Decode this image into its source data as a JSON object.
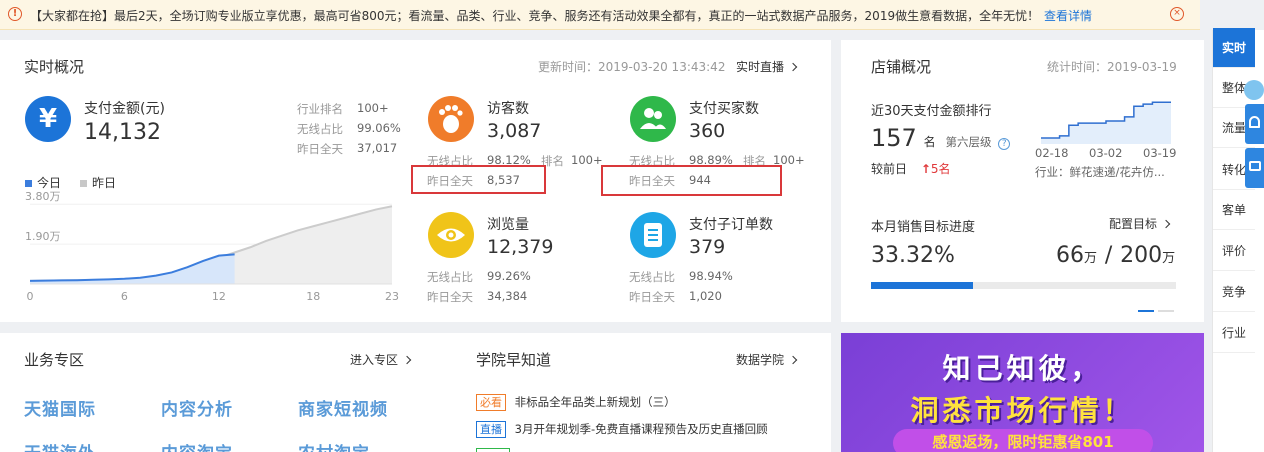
{
  "notice": {
    "text": "【大家都在抢】最后2天，全场订购专业版立享优惠，最高可省800元；看流量、品类、行业、竞争、服务还有活动效果全都有，真正的一站式数据产品服务，2019做生意看数据，全年无忧！",
    "link": "查看详情",
    "icon": "!",
    "close_icon": "×"
  },
  "realtime": {
    "title": "实时概况",
    "update_time": "更新时间：2019-03-20 13:43:42",
    "live_link": "实时直播",
    "pay_amount": {
      "label": "支付金额(元)",
      "value": "14,132",
      "icon": "¥",
      "stats": [
        {
          "label": "行业排名",
          "value": "100+"
        },
        {
          "label": "无线占比",
          "value": "99.06%"
        },
        {
          "label": "昨日全天",
          "value": "37,017"
        }
      ]
    },
    "legend": {
      "today": "今日",
      "yesterday": "昨日"
    },
    "metrics": [
      {
        "label": "访客数",
        "value": "3,087",
        "color": "#f07c2a",
        "icon": "foot-icon",
        "wireless_label": "无线占比",
        "wireless": "98.12%",
        "rank_label": "排名",
        "rank": "100+",
        "yesterday_label": "昨日全天",
        "yesterday": "8,537"
      },
      {
        "label": "支付买家数",
        "value": "360",
        "color": "#2fb84a",
        "icon": "buyers-icon",
        "wireless_label": "无线占比",
        "wireless": "98.89%",
        "rank_label": "排名",
        "rank": "100+",
        "yesterday_label": "昨日全天",
        "yesterday": "944"
      },
      {
        "label": "浏览量",
        "value": "12,379",
        "color": "#f0c419",
        "icon": "eye-icon",
        "wireless_label": "无线占比",
        "wireless": "99.26%",
        "yesterday_label": "昨日全天",
        "yesterday": "34,384"
      },
      {
        "label": "支付子订单数",
        "value": "379",
        "color": "#1ea6e6",
        "icon": "order-icon",
        "wireless_label": "无线占比",
        "wireless": "98.94%",
        "yesterday_label": "昨日全天",
        "yesterday": "1,020"
      }
    ]
  },
  "store": {
    "title": "店铺概况",
    "stat_time": "统计时间：2019-03-19",
    "rank_title": "近30天支付金额排行",
    "rank_value": "157",
    "rank_unit": "名",
    "level": "第六层级",
    "help_icon": "?",
    "compare_label": "较前日",
    "compare_value": "5名",
    "compare_arrow": "↑",
    "industry": "行业：鲜花速递/花卉仿...",
    "target_title": "本月销售目标进度",
    "config_link": "配置目标",
    "percent": "33.32%",
    "progress": 0.3332,
    "done": "66",
    "done_unit": "万",
    "slash": "/",
    "goal": "200",
    "goal_unit": "万"
  },
  "chart_data": [
    {
      "type": "area",
      "series": [
        {
          "name": "今日",
          "x": [
            0,
            1,
            2,
            3,
            4,
            5,
            6,
            7,
            8,
            9,
            10,
            11,
            12,
            13
          ],
          "values": [
            1500,
            1600,
            1700,
            1800,
            2000,
            2200,
            2500,
            3000,
            4000,
            5500,
            8000,
            11000,
            13500,
            14132
          ]
        },
        {
          "name": "昨日",
          "x": [
            0,
            1,
            2,
            3,
            4,
            5,
            6,
            7,
            8,
            9,
            10,
            11,
            12,
            13,
            14,
            15,
            16,
            17,
            18,
            19,
            20,
            21,
            22,
            23
          ],
          "values": [
            1500,
            1600,
            1700,
            1800,
            1900,
            2000,
            2200,
            2600,
            3500,
            5000,
            7500,
            10000,
            12500,
            15000,
            17500,
            20500,
            23000,
            25500,
            27500,
            29500,
            31500,
            33500,
            35500,
            37017
          ]
        }
      ],
      "x_ticks": [
        "0",
        "6",
        "12",
        "18",
        "23"
      ],
      "y_ticks": [
        "3.80万",
        "1.90万"
      ],
      "ylim": [
        0,
        40000
      ]
    },
    {
      "type": "line",
      "series": [
        {
          "x": [
            "02-18",
            "02-20",
            "02-22",
            "02-24",
            "02-26",
            "02-28",
            "03-02",
            "03-04",
            "03-06",
            "03-08",
            "03-10",
            "03-12",
            "03-14",
            "03-16",
            "03-19"
          ],
          "values": [
            1000,
            1000,
            950,
            700,
            650,
            650,
            650,
            600,
            600,
            500,
            250,
            200,
            157,
            157,
            157
          ]
        }
      ],
      "x_ticks": [
        "02-18",
        "03-02",
        "03-19"
      ],
      "y_inverted": true
    }
  ],
  "sidebar": {
    "items": [
      "实时",
      "整体",
      "流量",
      "转化",
      "客单",
      "评价",
      "竞争",
      "行业"
    ]
  },
  "business": {
    "title": "业务专区",
    "link": "进入专区",
    "items": [
      "天猫国际",
      "内容分析",
      "商家短视频",
      "天猫海外",
      "内容淘宝",
      "农村淘宝"
    ]
  },
  "academy": {
    "title": "学院早知道",
    "link": "数据学院",
    "news": [
      {
        "tag": "必看",
        "tag_color": "#f07c2a",
        "text": "非标品全年品类上新规划（三）"
      },
      {
        "tag": "直播",
        "tag_color": "#1c74d8",
        "text": "3月开年规划季-免费直播课程预告及历史直播回顾"
      }
    ]
  },
  "promo": {
    "line1": "知己知彼，",
    "line2": "洞悉市场行情！",
    "line3": "感恩返场，限时钜惠省801"
  },
  "colors": {
    "accent": "#1c74d8",
    "today": "#3b7ddd",
    "yesterday": "#c8c8c8",
    "highlight": "#d9383a"
  }
}
